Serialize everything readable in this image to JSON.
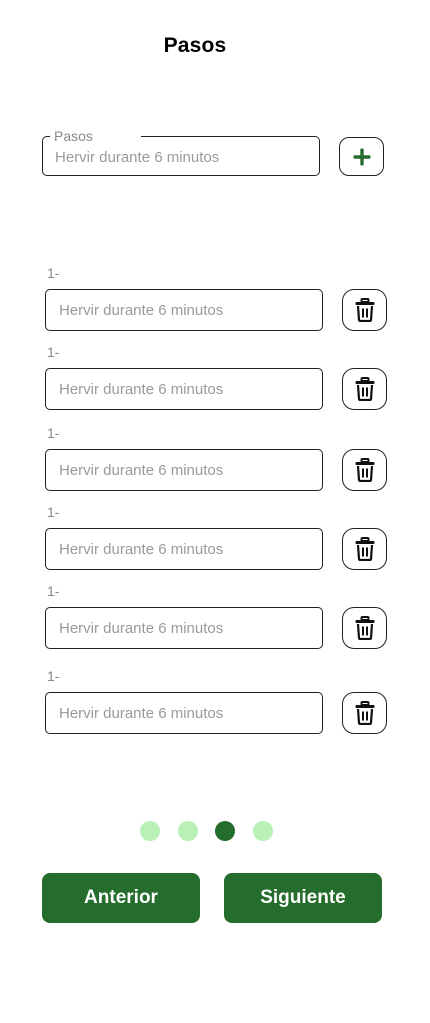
{
  "header": {
    "title": "Pasos"
  },
  "main_field": {
    "label": "Pasos",
    "placeholder": "Hervir durante 6 minutos"
  },
  "add_button": {
    "icon": "plus-icon"
  },
  "steps": [
    {
      "number": "1-",
      "placeholder": "Hervir durante 6 minutos"
    },
    {
      "number": "1-",
      "placeholder": "Hervir durante 6 minutos"
    },
    {
      "number": "1-",
      "placeholder": "Hervir durante 6 minutos"
    },
    {
      "number": "1-",
      "placeholder": "Hervir durante 6 minutos"
    },
    {
      "number": "1-",
      "placeholder": "Hervir durante 6 minutos"
    },
    {
      "number": "1-",
      "placeholder": "Hervir durante 6 minutos"
    }
  ],
  "pagination": {
    "total": 4,
    "active_index": 2
  },
  "footer": {
    "prev_label": "Anterior",
    "next_label": "Siguiente"
  },
  "colors": {
    "primary": "#256d2c",
    "dot_inactive": "#b9f0b6",
    "dot_active": "#256d2c",
    "border": "#222222",
    "placeholder": "#9a9a9a"
  }
}
